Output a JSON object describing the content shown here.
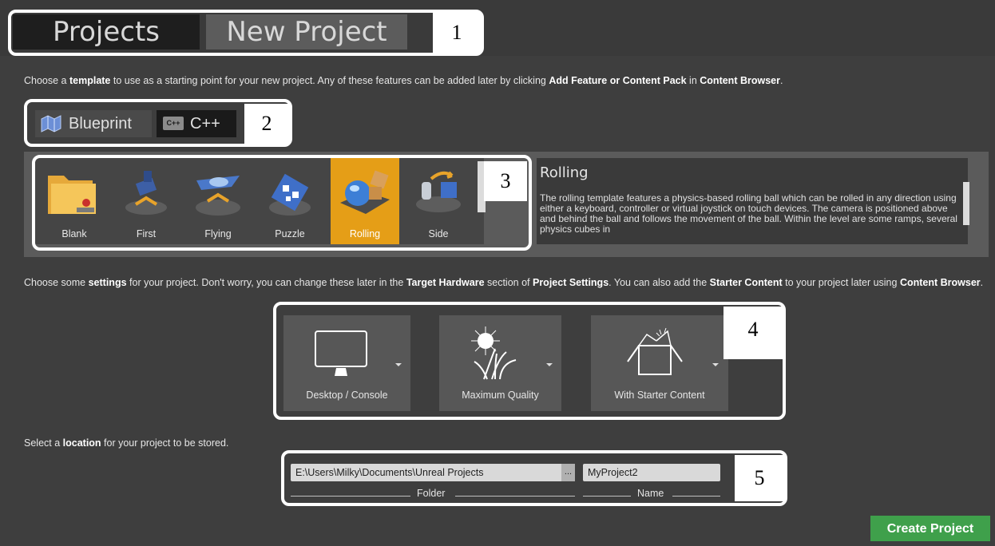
{
  "tabs": {
    "projects": "Projects",
    "new_project": "New Project"
  },
  "callouts": [
    "1",
    "2",
    "3",
    "4",
    "5"
  ],
  "intro": {
    "part1": "Choose a ",
    "bold1": "template",
    "part2": " to use as a starting point for your new project.  Any of these features can be added later by clicking ",
    "bold2": "Add Feature or Content Pack",
    "part3": " in ",
    "bold3": "Content Browser",
    "part4": "."
  },
  "languages": {
    "blueprint": "Blueprint",
    "cpp": "C++",
    "cpp_badge": "C++",
    "selected": "C++"
  },
  "templates": [
    {
      "label": "Blank",
      "icon": "folder-icon"
    },
    {
      "label": "First",
      "icon": "first-person-icon"
    },
    {
      "label": "Flying",
      "icon": "spaceship-icon"
    },
    {
      "label": "Puzzle",
      "icon": "puzzle-icon"
    },
    {
      "label": "Rolling",
      "icon": "rolling-ball-icon",
      "selected": true
    },
    {
      "label": "Side",
      "icon": "side-scroller-icon"
    }
  ],
  "description": {
    "title": "Rolling",
    "body": "The rolling template features a physics-based rolling ball which can be rolled in any direction using either a keyboard, controller or virtual joystick on touch devices. The camera is positioned above and behind the ball and follows the movement of the ball. Within the level are some ramps, several physics cubes in"
  },
  "settings_text": {
    "part1": "Choose some ",
    "bold1": "settings",
    "part2": " for your project.  Don't worry, you can change these later in the ",
    "bold2": "Target Hardware",
    "part3": " section of ",
    "bold3": "Project Settings",
    "part4": ".  You can also add the ",
    "bold4": "Starter Content",
    "part5": " to your project later using ",
    "bold5": "Content Browser",
    "part6": "."
  },
  "settings": [
    {
      "label": "Desktop / Console",
      "icon": "monitor-icon"
    },
    {
      "label": "Maximum Quality",
      "icon": "quality-sun-grass-icon"
    },
    {
      "label": "With Starter Content",
      "icon": "starter-content-box-icon"
    }
  ],
  "location_text": {
    "part1": "Select a ",
    "bold1": "location",
    "part2": " for your project to be stored."
  },
  "folder": {
    "value": "E:\\Users\\Milky\\Documents\\Unreal Projects",
    "browse": "...",
    "label": "Folder"
  },
  "name": {
    "value": "MyProject2",
    "label": "Name"
  },
  "create_button": "Create Project",
  "colors": {
    "selected_template": "#e59e17",
    "create_button": "#3fa04b",
    "callout": "#ffffff"
  }
}
